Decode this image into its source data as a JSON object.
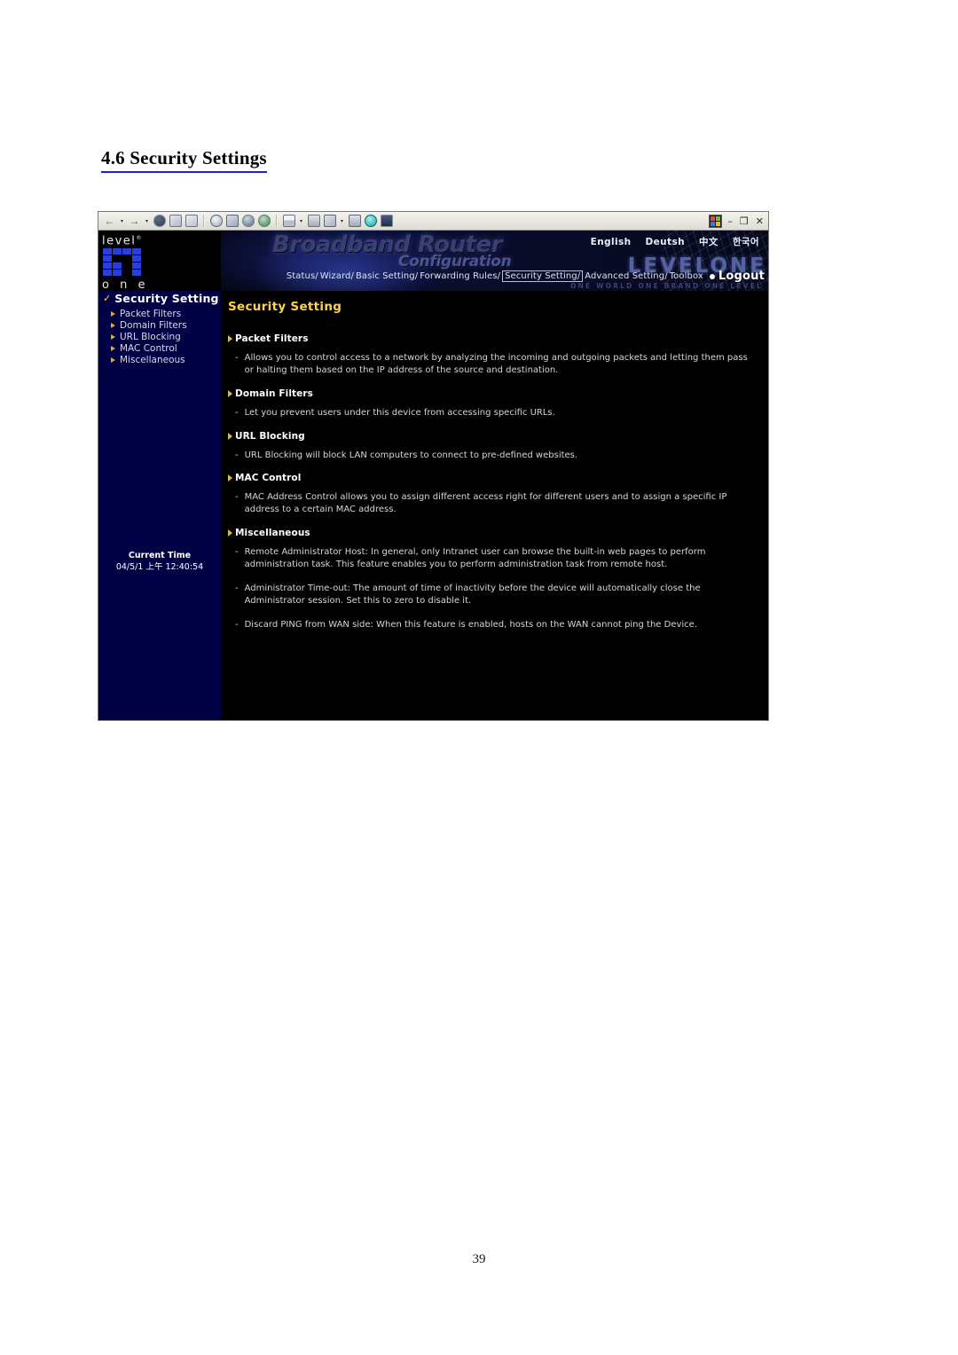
{
  "document": {
    "heading": "4.6 Security Settings",
    "page_number": "39"
  },
  "browser": {
    "toolbar_icons": [
      "back-arrow-icon",
      "back-dropdown-caret-icon",
      "forward-arrow-icon",
      "forward-dropdown-caret-icon",
      "stop-icon",
      "refresh-icon",
      "home-icon",
      "search-icon",
      "favorites-icon",
      "media-icon",
      "history-icon",
      "mail-icon",
      "mail-dropdown-caret-icon",
      "print-icon",
      "edit-icon",
      "edit-dropdown-caret-icon",
      "discuss-icon",
      "messenger-icon",
      "research-icon"
    ],
    "back_arrow": "←",
    "forward_arrow": "→",
    "caret": "▾",
    "window_minimize": "–",
    "window_restore": "❐",
    "window_close": "✕"
  },
  "brand": {
    "level": "level",
    "registered": "®",
    "one": "o n e",
    "logo_rows": [
      [
        1,
        1,
        1,
        1
      ],
      [
        1,
        0,
        0,
        1
      ],
      [
        1,
        1,
        0,
        1
      ],
      [
        1,
        1,
        0,
        1
      ]
    ]
  },
  "sidebar": {
    "header": {
      "check": "✓",
      "label": "Security Setting"
    },
    "items": [
      {
        "label": "Packet Filters"
      },
      {
        "label": "Domain Filters"
      },
      {
        "label": "URL Blocking"
      },
      {
        "label": "MAC Control"
      },
      {
        "label": "Miscellaneous"
      }
    ],
    "clock": {
      "label": "Current Time",
      "value": "04/5/1 上午 12:40:54"
    }
  },
  "banner": {
    "title": "Broadband Router",
    "subtitle": "Configuration",
    "watermark": "LEVELONE",
    "tagline": "ONE WORLD ONE BRAND ONE LEVEL",
    "languages": [
      {
        "label": "English"
      },
      {
        "label": "Deutsh"
      },
      {
        "label": "中文"
      },
      {
        "label": "한국어"
      }
    ],
    "breadcrumbs": [
      {
        "label": "Status/",
        "active": false
      },
      {
        "label": "Wizard/",
        "active": false
      },
      {
        "label": "Basic Setting/",
        "active": false
      },
      {
        "label": "Forwarding Rules/",
        "active": false
      },
      {
        "label": "Security Setting/",
        "active": true
      },
      {
        "label": "Advanced Setting/",
        "active": false
      },
      {
        "label": "Toolbox",
        "active": false
      }
    ],
    "logout_label": "Logout"
  },
  "main": {
    "title": "Security Setting",
    "sections": [
      {
        "heading": "Packet Filters",
        "items": [
          "Allows you to control access to a network by analyzing the incoming and outgoing packets and letting them pass or halting them based on the IP address of the source and destination."
        ]
      },
      {
        "heading": "Domain Filters",
        "items": [
          "Let you prevent users under this device from accessing specific URLs."
        ]
      },
      {
        "heading": "URL Blocking",
        "items": [
          "URL Blocking will block LAN computers to connect to pre-defined websites."
        ]
      },
      {
        "heading": "MAC Control",
        "items": [
          "MAC Address Control allows you to assign different access right for different users and to assign a specific IP address to a certain MAC address."
        ]
      },
      {
        "heading": "Miscellaneous",
        "items": [
          "Remote Administrator Host: In general, only Intranet user can browse the built-in web pages to perform administration task. This feature enables you to perform administration task from remote host.",
          "Administrator Time-out: The amount of time of inactivity before the device will automatically close the Administrator session. Set this to zero to disable it.",
          "Discard PING from WAN side: When this feature is enabled, hosts on the WAN cannot ping the Device."
        ]
      }
    ],
    "dash": "-"
  },
  "colors": {
    "accent_yellow": "#ffd24a",
    "bullet_orange": "#f0a81e",
    "sidebar_navy": "#000044",
    "pane_black": "#000000",
    "heading_rule": "#2222bb"
  }
}
